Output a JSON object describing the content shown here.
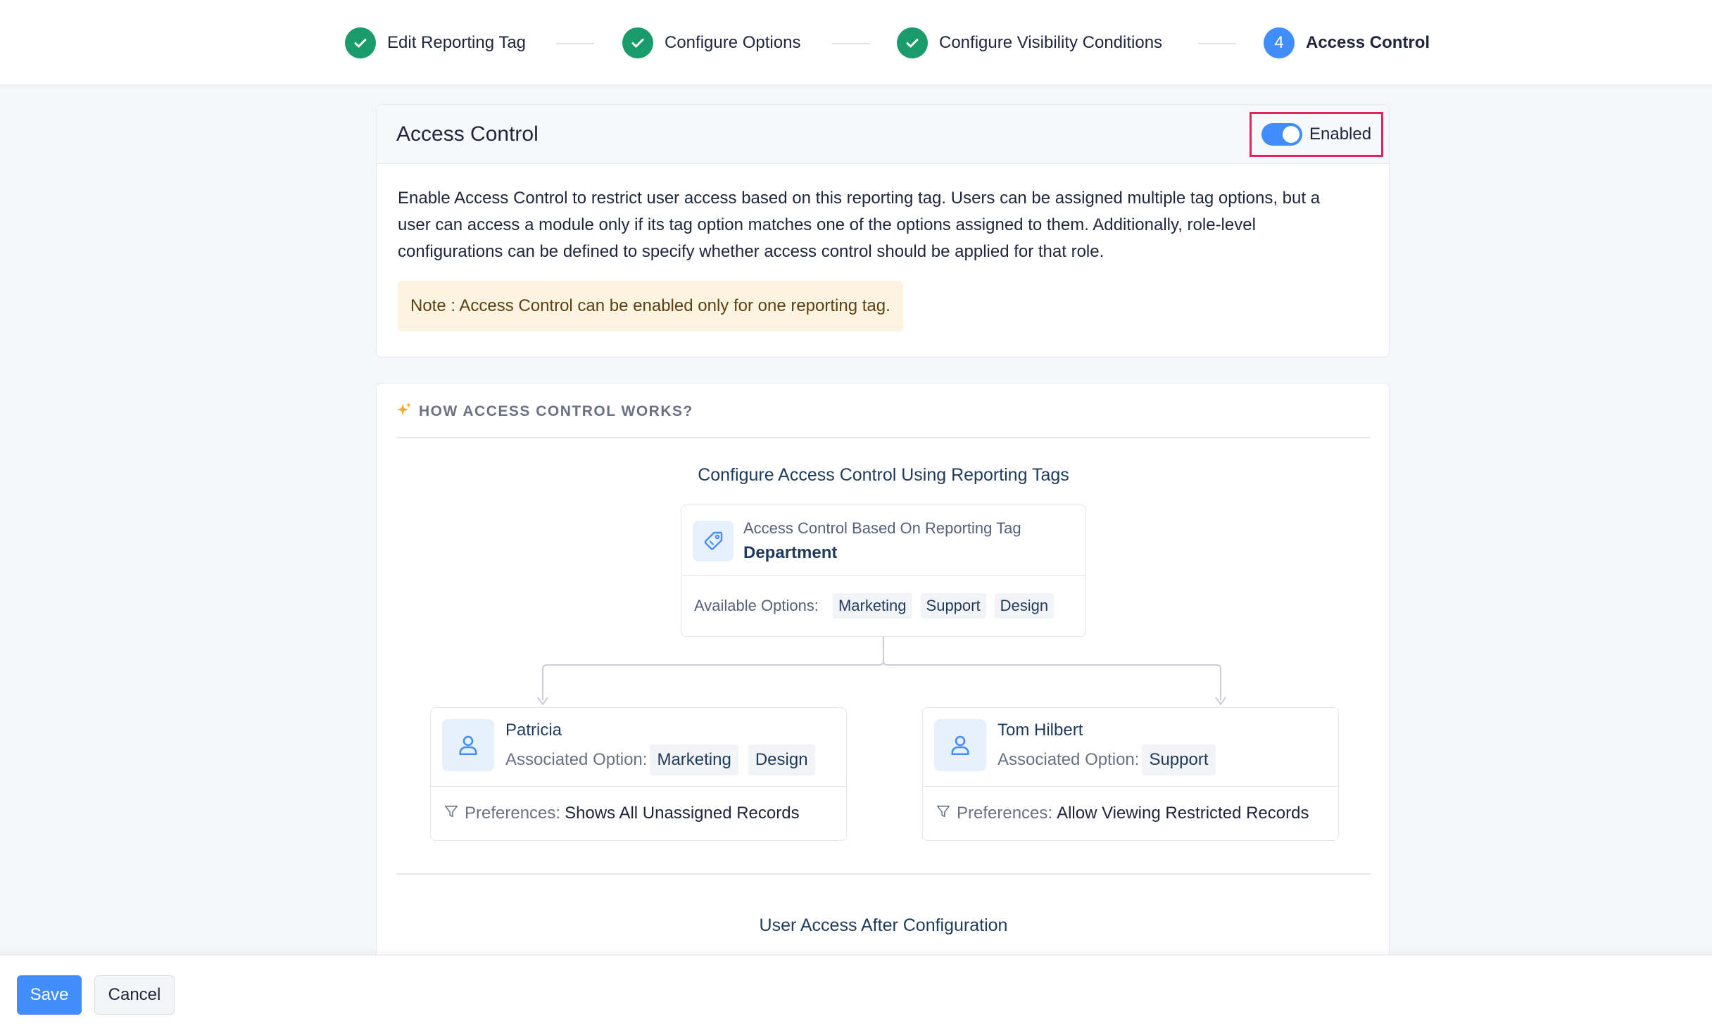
{
  "stepper": {
    "steps": [
      {
        "label": "Edit Reporting Tag",
        "status": "completed",
        "icon": "check-icon"
      },
      {
        "label": "Configure Options",
        "status": "completed",
        "icon": "check-icon"
      },
      {
        "label": "Configure Visibility Conditions",
        "status": "completed",
        "icon": "check-icon"
      },
      {
        "label": "Access Control",
        "status": "active",
        "number": "4"
      }
    ]
  },
  "access_control": {
    "title": "Access Control",
    "toggle_label": "Enabled",
    "toggle_on": true,
    "description": "Enable Access Control to restrict user access based on this reporting tag. Users can be assigned multiple tag options, but a user can access a module only if its tag option matches one of the options assigned to them. Additionally, role-level configurations can be defined to specify whether access control should be applied for that role.",
    "note": "Note : Access Control can be enabled only for one reporting tag."
  },
  "how_it_works": {
    "heading": "HOW ACCESS CONTROL WORKS?",
    "diagram_title": "Configure Access Control Using Reporting Tags",
    "tag_caption": "Access Control Based On Reporting Tag",
    "tag_value": "Department",
    "available_label": "Available Options:",
    "available_options": [
      "Marketing",
      "Support",
      "Design"
    ],
    "users": [
      {
        "name": "Patricia",
        "assoc_label": "Associated Option:",
        "options": [
          "Marketing",
          "Design"
        ],
        "pref_label": "Preferences:",
        "pref_value": "Shows All Unassigned Records"
      },
      {
        "name": "Tom Hilbert",
        "assoc_label": "Associated Option:",
        "options": [
          "Support"
        ],
        "pref_label": "Preferences:",
        "pref_value": "Allow Viewing Restricted Records"
      }
    ],
    "after_title": "User Access After Configuration"
  },
  "footer": {
    "save_label": "Save",
    "cancel_label": "Cancel"
  },
  "colors": {
    "primary": "#408dfb",
    "success": "#1a9b6b",
    "highlight_border": "#e3245a",
    "note_bg": "#fdf3e1"
  }
}
